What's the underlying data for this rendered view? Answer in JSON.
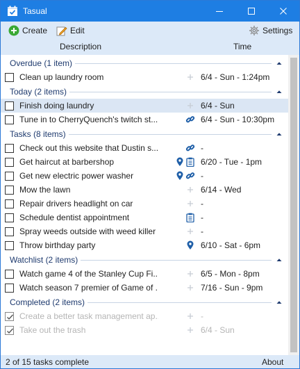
{
  "window": {
    "title": "Tasual"
  },
  "toolbar": {
    "create_label": "Create",
    "edit_label": "Edit",
    "settings_label": "Settings"
  },
  "columns": {
    "description": "Description",
    "time": "Time"
  },
  "colors": {
    "titlebar": "#1e7ee3",
    "toolbar": "#dce9f8",
    "icon_blue": "#1f5fa8",
    "selected_row": "#dbe6f4",
    "completed_text": "#b5b5b5"
  },
  "groups": [
    {
      "title": "Overdue (1 item)",
      "items": [
        {
          "description": "Clean up laundry room",
          "time": "6/4 - Sun - 1:24pm",
          "icons": [
            "plus-icon"
          ],
          "checked": false
        }
      ]
    },
    {
      "title": "Today (2 items)",
      "items": [
        {
          "description": "Finish doing laundry",
          "time": "6/4 - Sun",
          "icons": [
            "plus-icon"
          ],
          "checked": false,
          "selected": true
        },
        {
          "description": "Tune in to CherryQuench's twitch st...",
          "time": "6/4 - Sun - 10:30pm",
          "icons": [
            "link-icon"
          ],
          "checked": false
        }
      ]
    },
    {
      "title": "Tasks (8 items)",
      "items": [
        {
          "description": "Check out this website that Dustin s...",
          "time": "-",
          "icons": [
            "link-icon"
          ],
          "checked": false
        },
        {
          "description": "Get haircut at barbershop",
          "time": "6/20 - Tue - 1pm",
          "icons": [
            "location-pin-icon",
            "clipboard-icon"
          ],
          "checked": false
        },
        {
          "description": "Get new electric power washer",
          "time": "-",
          "icons": [
            "location-pin-icon",
            "link-icon"
          ],
          "checked": false
        },
        {
          "description": "Mow the lawn",
          "time": "6/14 - Wed",
          "icons": [
            "plus-icon"
          ],
          "checked": false
        },
        {
          "description": "Repair drivers headlight on car",
          "time": "-",
          "icons": [
            "plus-icon"
          ],
          "checked": false
        },
        {
          "description": "Schedule dentist appointment",
          "time": "-",
          "icons": [
            "clipboard-icon"
          ],
          "checked": false
        },
        {
          "description": "Spray weeds outside with weed killer",
          "time": "-",
          "icons": [
            "plus-icon"
          ],
          "checked": false
        },
        {
          "description": "Throw birthday party",
          "time": "6/10 - Sat - 6pm",
          "icons": [
            "location-pin-icon"
          ],
          "checked": false
        }
      ]
    },
    {
      "title": "Watchlist (2 items)",
      "items": [
        {
          "description": "Watch game 4 of the Stanley Cup Fi...",
          "time": "6/5 - Mon - 8pm",
          "icons": [
            "plus-icon"
          ],
          "checked": false
        },
        {
          "description": "Watch season 7 premier of Game of ...",
          "time": "7/16 - Sun - 9pm",
          "icons": [
            "plus-icon"
          ],
          "checked": false
        }
      ]
    },
    {
      "title": "Completed (2 items)",
      "items": [
        {
          "description": "Create a better task management ap...",
          "time": "-",
          "icons": [
            "plus-icon"
          ],
          "checked": true
        },
        {
          "description": "Take out the trash",
          "time": "6/4 - Sun",
          "icons": [
            "plus-icon"
          ],
          "checked": true
        }
      ]
    }
  ],
  "status": {
    "count_text": "2 of 15 tasks complete",
    "about_label": "About"
  }
}
